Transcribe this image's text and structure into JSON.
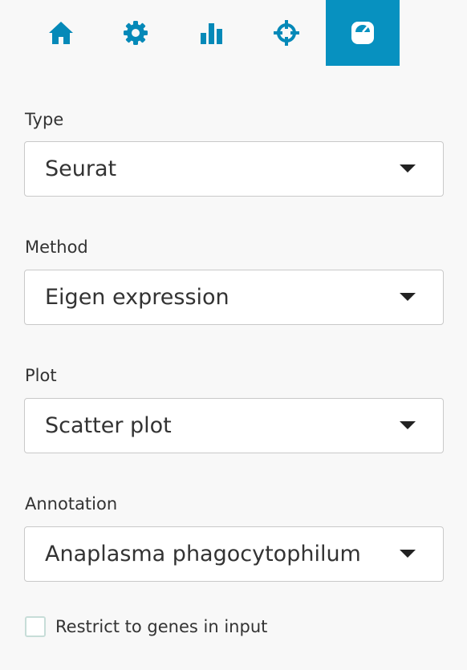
{
  "colors": {
    "accent": "#0791c0",
    "icon": "#0589b8",
    "active_icon": "#ffffff"
  },
  "tabs": [
    {
      "icon": "home-icon",
      "active": false
    },
    {
      "icon": "gear-icon",
      "active": false
    },
    {
      "icon": "bar-chart-icon",
      "active": false
    },
    {
      "icon": "crosshairs-icon",
      "active": false
    },
    {
      "icon": "gauge-icon",
      "active": true
    }
  ],
  "form": {
    "type": {
      "label": "Type",
      "value": "Seurat"
    },
    "method": {
      "label": "Method",
      "value": "Eigen expression"
    },
    "plot": {
      "label": "Plot",
      "value": "Scatter plot"
    },
    "annotation": {
      "label": "Annotation",
      "value": "Anaplasma phagocytophilum"
    },
    "restrict": {
      "label": "Restrict to genes in input",
      "checked": false
    }
  }
}
